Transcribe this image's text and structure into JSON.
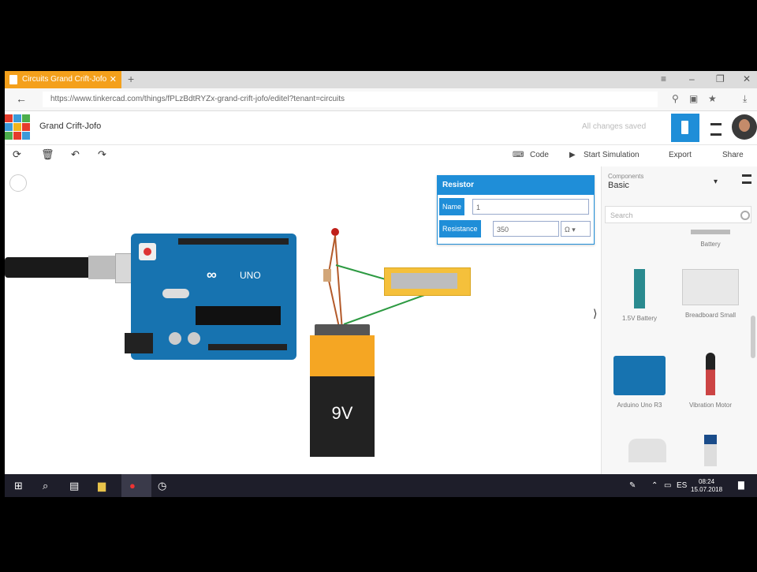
{
  "browser": {
    "tab_title": "Circuits Grand Crift-Jofo",
    "new_tab": "+",
    "window_controls": [
      "≡",
      "–",
      "❐",
      "✕"
    ],
    "url": "https://www.tinkercad.com/things/fPLzBdtRYZx-grand-crift-jofo/editel?tenant=circuits"
  },
  "app": {
    "design_name": "Grand Crift-Jofo",
    "save_status": "All changes saved",
    "logo_colors": [
      "#e43c2c",
      "#3b9ad9",
      "#4cae4c",
      "#3b9ad9",
      "#f0b41c",
      "#e43c2c",
      "#4cae4c",
      "#e43c2c",
      "#3b9ad9"
    ]
  },
  "toolbar": {
    "code_label": "Code",
    "start_simulation_label": "Start Simulation",
    "export_label": "Export",
    "share_label": "Share"
  },
  "inspector": {
    "title": "Resistor",
    "name_label": "Name",
    "name_value": "1",
    "resistance_label": "Resistance",
    "resistance_value": "350",
    "unit_value": "Ω"
  },
  "components": {
    "selector_label": "Components",
    "selector_value": "Basic",
    "search_placeholder": "Search",
    "items": [
      {
        "label": "Battery"
      },
      {
        "label": "1.5V Battery"
      },
      {
        "label": "Breadboard Small"
      },
      {
        "label": "Arduino Uno R3"
      },
      {
        "label": "Vibration Motor"
      }
    ]
  },
  "circuit": {
    "board_label": "UNO",
    "battery_label": "9V"
  },
  "taskbar": {
    "time": "08:24",
    "date": "15.07.2018",
    "language": "ES"
  },
  "colors": {
    "accent": "#1f8ed8",
    "tab": "#f4a01b",
    "arduino": "#1773b0",
    "battery_top": "#f5a623",
    "resistor_box": "#f5c03b"
  }
}
